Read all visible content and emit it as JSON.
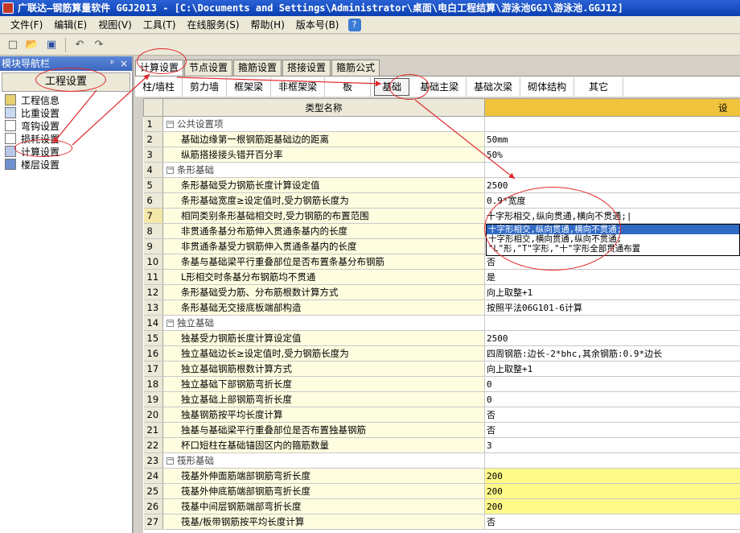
{
  "window": {
    "title": "广联达—钢筋算量软件 GGJ2013 - [C:\\Documents and Settings\\Administrator\\桌面\\电白工程结算\\游泳池GGJ\\游泳池.GGJ12]"
  },
  "menu": {
    "items": [
      "文件(F)",
      "编辑(E)",
      "视图(V)",
      "工具(T)",
      "在线服务(S)",
      "帮助(H)",
      "版本号(B)"
    ]
  },
  "toolbar": {
    "icons": [
      "new-icon",
      "open-icon",
      "save-icon",
      "undo-icon",
      "redo-icon"
    ]
  },
  "nav": {
    "header": "模块导航栏",
    "pin": "ᵖ",
    "close": "×",
    "section_button": "工程设置",
    "items": [
      "工程信息",
      "比重设置",
      "弯钩设置",
      "损耗设置",
      "计算设置",
      "楼层设置"
    ]
  },
  "tabs_top": [
    "计算设置",
    "节点设置",
    "箍筋设置",
    "搭接设置",
    "箍筋公式"
  ],
  "tabs_sub": [
    "柱/墙柱",
    "剪力墙",
    "框架梁",
    "非框架梁",
    "板",
    "基础",
    "基础主梁",
    "基础次梁",
    "砌体结构",
    "其它"
  ],
  "grid": {
    "col_name_header": "类型名称",
    "col_value_header": "设",
    "rows": [
      {
        "no": "1",
        "name": "公共设置项",
        "value": "",
        "group": true
      },
      {
        "no": "2",
        "name": "基础边缘第一根钢筋距基础边的距离",
        "value": "50mm"
      },
      {
        "no": "3",
        "name": "纵筋搭接接头错开百分率",
        "value": "50%"
      },
      {
        "no": "4",
        "name": "条形基础",
        "value": "",
        "group": true
      },
      {
        "no": "5",
        "name": "条形基础受力钢筋长度计算设定值",
        "value": "2500"
      },
      {
        "no": "6",
        "name": "条形基础宽度≥设定值时,受力钢筋长度为",
        "value": "0.9*宽度"
      },
      {
        "no": "7",
        "name": "相同类别条形基础相交时,受力钢筋的布置范围",
        "value": "十字形相交,纵向贯通,横向不贯通;|"
      },
      {
        "no": "8",
        "name": "非贯通条基分布筋伸入贯通条基内的长度",
        "value": ""
      },
      {
        "no": "9",
        "name": "非贯通条基受力钢筋伸入贯通条基内的长度",
        "value": ""
      },
      {
        "no": "10",
        "name": "条基与基础梁平行重叠部位是否布置条基分布钢筋",
        "value": "否"
      },
      {
        "no": "11",
        "name": "L形相交时条基分布钢筋均不贯通",
        "value": "是"
      },
      {
        "no": "12",
        "name": "条形基础受力筋、分布筋根数计算方式",
        "value": "向上取整+1"
      },
      {
        "no": "13",
        "name": "条形基础无交接底板端部构造",
        "value": "按照平法06G101-6计算"
      },
      {
        "no": "14",
        "name": "独立基础",
        "value": "",
        "group": true
      },
      {
        "no": "15",
        "name": "独基受力钢筋长度计算设定值",
        "value": "2500"
      },
      {
        "no": "16",
        "name": "独立基础边长≥设定值时,受力钢筋长度为",
        "value": "四周钢筋:边长-2*bhc,其余钢筋:0.9*边长"
      },
      {
        "no": "17",
        "name": "独立基础钢筋根数计算方式",
        "value": "向上取整+1"
      },
      {
        "no": "18",
        "name": "独立基础下部钢筋弯折长度",
        "value": "0"
      },
      {
        "no": "19",
        "name": "独立基础上部钢筋弯折长度",
        "value": "0"
      },
      {
        "no": "20",
        "name": "独基钢筋按平均长度计算",
        "value": "否"
      },
      {
        "no": "21",
        "name": "独基与基础梁平行重叠部位是否布置独基钢筋",
        "value": "否"
      },
      {
        "no": "22",
        "name": "杯口短柱在基础锚固区内的箍筋数量",
        "value": "3"
      },
      {
        "no": "23",
        "name": "筏形基础",
        "value": "",
        "group": true
      },
      {
        "no": "24",
        "name": "筏基外伸面筋端部钢筋弯折长度",
        "value": "200",
        "highlight": true
      },
      {
        "no": "25",
        "name": "筏基外伸底筋端部钢筋弯折长度",
        "value": "200",
        "highlight": true
      },
      {
        "no": "26",
        "name": "筏基中间层钢筋端部弯折长度",
        "value": "200",
        "highlight": true
      },
      {
        "no": "27",
        "name": "筏基/板带钢筋按平均长度计算",
        "value": "否"
      }
    ]
  },
  "dropdown": {
    "options": [
      "十字形相交,纵向贯通,横向不贯通;",
      "十字形相交,横向贯通,纵向不贯通;",
      "\"L\"形,\"T\"字形,\"十\"字形全部贯通布置"
    ]
  },
  "colors": {
    "title_bar": "#0a3fb0",
    "header_value": "#f0c33c",
    "highlight_cell": "#fff98a",
    "annotation": "#e0262a",
    "selection": "#316ac5"
  }
}
